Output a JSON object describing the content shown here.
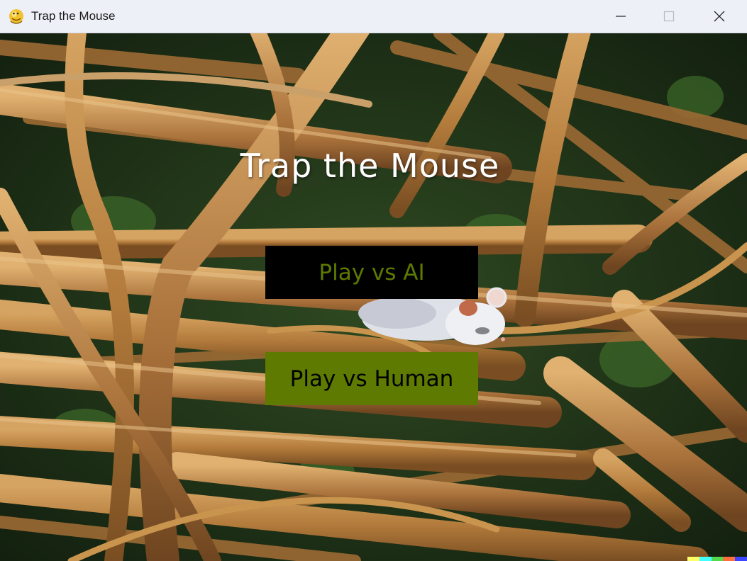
{
  "window": {
    "title": "Trap the Mouse",
    "app_icon": "python-snake-icon",
    "controls": [
      "minimize-icon",
      "maximize-icon",
      "close-icon"
    ]
  },
  "menu": {
    "title": "Trap the Mouse",
    "buttons": [
      {
        "label": "Play vs AI",
        "background": "#000000",
        "text_color": "#5e7a00"
      },
      {
        "label": "Play vs Human",
        "background": "#5e7a00",
        "text_color": "#000000"
      }
    ]
  },
  "background": {
    "description_icon": "tangled-branches-with-mouse",
    "watermark_colors": [
      "#ffff66",
      "#42ffff",
      "#51da4c",
      "#ff6e3c",
      "#3c46ff"
    ]
  }
}
